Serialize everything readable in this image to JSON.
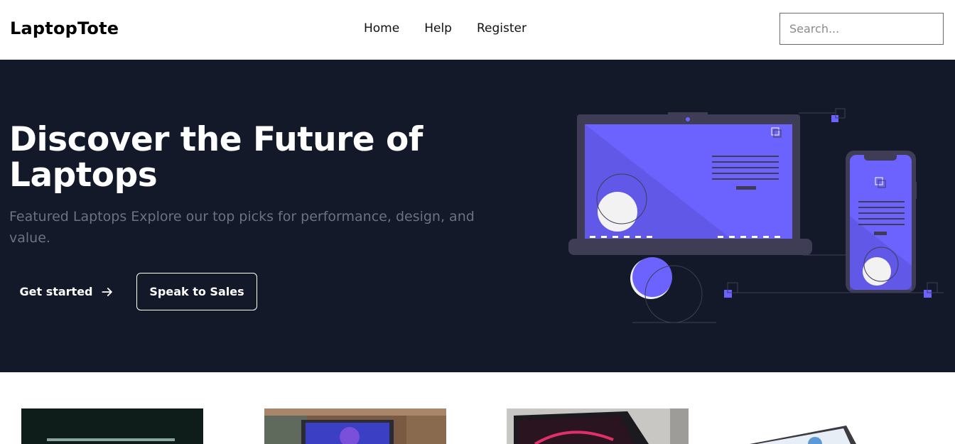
{
  "header": {
    "logo": "LaptopTote",
    "nav": [
      {
        "label": "Home"
      },
      {
        "label": "Help"
      },
      {
        "label": "Register"
      }
    ],
    "search_placeholder": "Search..."
  },
  "hero": {
    "title": "Discover the Future of Laptops",
    "subtitle": "Featured Laptops Explore our top picks for performance, design, and value.",
    "primary_cta": "Get started",
    "secondary_cta": "Speak to Sales",
    "background_color": "#131929",
    "accent_color": "#6c63ff"
  },
  "products": [
    {
      "icon": "laptop-photo-dark"
    },
    {
      "icon": "laptop-photo-desk"
    },
    {
      "icon": "laptop-photo-red-screen"
    },
    {
      "icon": "laptop-photo-white"
    }
  ]
}
